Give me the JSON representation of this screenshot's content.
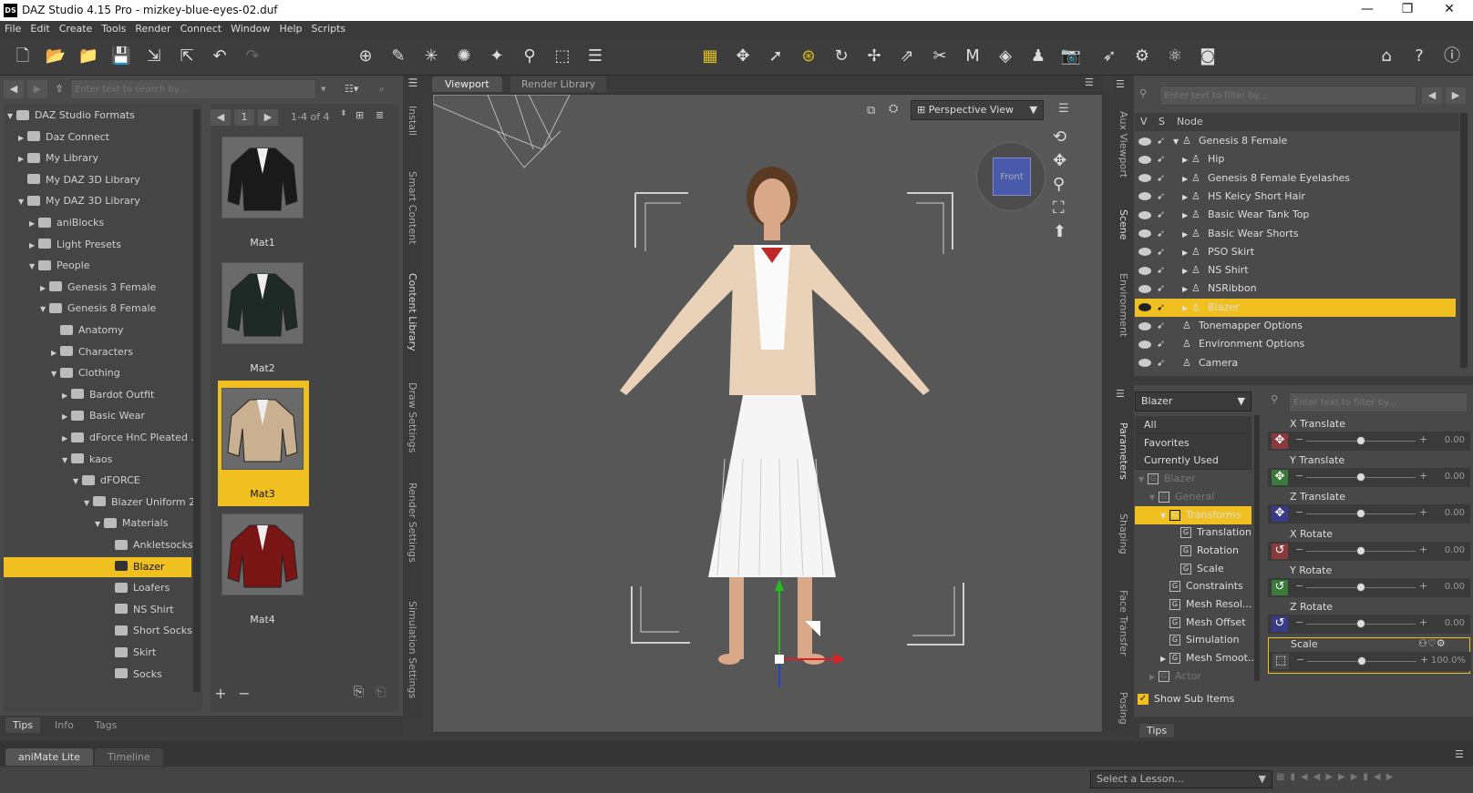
{
  "window": {
    "title": "DAZ Studio 4.15 Pro - mizkey-blue-eyes-02.duf",
    "logo": "DS"
  },
  "menu": [
    "File",
    "Edit",
    "Create",
    "Tools",
    "Render",
    "Connect",
    "Window",
    "Help",
    "Scripts"
  ],
  "content_library": {
    "search_placeholder": "Enter text to search by...",
    "tree": [
      {
        "label": "DAZ Studio Formats",
        "indent": 0,
        "arrow": "▼"
      },
      {
        "label": "Daz Connect",
        "indent": 1,
        "arrow": "▶"
      },
      {
        "label": "My Library",
        "indent": 1,
        "arrow": "▶"
      },
      {
        "label": "My DAZ 3D Library",
        "indent": 1,
        "arrow": ""
      },
      {
        "label": "My DAZ 3D Library",
        "indent": 1,
        "arrow": "▼"
      },
      {
        "label": "aniBlocks",
        "indent": 2,
        "arrow": "▶"
      },
      {
        "label": "Light Presets",
        "indent": 2,
        "arrow": "▶"
      },
      {
        "label": "People",
        "indent": 2,
        "arrow": "▼"
      },
      {
        "label": "Genesis 3 Female",
        "indent": 3,
        "arrow": "▶"
      },
      {
        "label": "Genesis 8 Female",
        "indent": 3,
        "arrow": "▼"
      },
      {
        "label": "Anatomy",
        "indent": 4,
        "arrow": ""
      },
      {
        "label": "Characters",
        "indent": 4,
        "arrow": "▶"
      },
      {
        "label": "Clothing",
        "indent": 4,
        "arrow": "▼"
      },
      {
        "label": "Bardot Outfit",
        "indent": 5,
        "arrow": "▶"
      },
      {
        "label": "Basic Wear",
        "indent": 5,
        "arrow": "▶"
      },
      {
        "label": "dForce HnC Pleated ...",
        "indent": 5,
        "arrow": "▶"
      },
      {
        "label": "kaos",
        "indent": 5,
        "arrow": "▼"
      },
      {
        "label": "dFORCE",
        "indent": 6,
        "arrow": "▼"
      },
      {
        "label": "Blazer Uniform 2",
        "indent": 7,
        "arrow": "▼"
      },
      {
        "label": "Materials",
        "indent": 8,
        "arrow": "▼"
      },
      {
        "label": "Ankletsocks",
        "indent": 9,
        "arrow": ""
      },
      {
        "label": "Blazer",
        "indent": 9,
        "arrow": "",
        "selected": true
      },
      {
        "label": "Loafers",
        "indent": 9,
        "arrow": ""
      },
      {
        "label": "NS Shirt",
        "indent": 9,
        "arrow": ""
      },
      {
        "label": "Short Socks",
        "indent": 9,
        "arrow": ""
      },
      {
        "label": "Skirt",
        "indent": 9,
        "arrow": ""
      },
      {
        "label": "Socks",
        "indent": 9,
        "arrow": ""
      }
    ],
    "page": "1",
    "range": "1-4 of 4",
    "thumbs": [
      {
        "label": "Mat1",
        "color": "#1a1a1a"
      },
      {
        "label": "Mat2",
        "color": "#1e2a26"
      },
      {
        "label": "Mat3",
        "color": "#c8b090",
        "selected": true
      },
      {
        "label": "Mat4",
        "color": "#7a1515"
      }
    ],
    "tabs": [
      "Tips",
      "Info",
      "Tags"
    ]
  },
  "side_tabs_left": [
    "Install",
    "Smart Content",
    "Content Library",
    "Draw Settings",
    "Render Settings",
    "Simulation Settings"
  ],
  "viewport": {
    "tabs": [
      "Viewport",
      "Render Library"
    ],
    "view_mode": "Perspective View",
    "cube_label": "Front"
  },
  "scene": {
    "filter_placeholder": "Enter text to filter by...",
    "headers": [
      "V",
      "S",
      "Node"
    ],
    "rows": [
      {
        "label": "Genesis 8 Female",
        "indent": 0,
        "arrow": "▼"
      },
      {
        "label": "Hip",
        "indent": 1,
        "arrow": "▶"
      },
      {
        "label": "Genesis 8 Female Eyelashes",
        "indent": 1,
        "arrow": "▶"
      },
      {
        "label": "HS Keicy Short Hair",
        "indent": 1,
        "arrow": "▶"
      },
      {
        "label": "Basic Wear Tank Top",
        "indent": 1,
        "arrow": "▶"
      },
      {
        "label": "Basic Wear Shorts",
        "indent": 1,
        "arrow": "▶"
      },
      {
        "label": "PSO Skirt",
        "indent": 1,
        "arrow": "▶"
      },
      {
        "label": "NS Shirt",
        "indent": 1,
        "arrow": "▶"
      },
      {
        "label": "NSRibbon",
        "indent": 1,
        "arrow": "▶"
      },
      {
        "label": "Blazer",
        "indent": 1,
        "arrow": "▶",
        "selected": true
      },
      {
        "label": "Tonemapper Options",
        "indent": 0,
        "arrow": ""
      },
      {
        "label": "Environment Options",
        "indent": 0,
        "arrow": ""
      },
      {
        "label": "Camera",
        "indent": 0,
        "arrow": ""
      }
    ]
  },
  "side_tabs_right": [
    "Aux Viewport",
    "Scene",
    "Environment",
    "Parameters",
    "Shaping",
    "Face Transfer",
    "Posing"
  ],
  "parameters": {
    "node": "Blazer",
    "filter_placeholder": "Enter text to filter by...",
    "groups": [
      {
        "label": "All",
        "indent": 0
      },
      {
        "label": "Favorites",
        "indent": 0
      },
      {
        "label": "Currently Used",
        "indent": 0
      },
      {
        "label": "Blazer",
        "indent": 0,
        "dim": true,
        "arrow": "▼"
      },
      {
        "label": "General",
        "indent": 1,
        "dim": true,
        "arrow": "▼"
      },
      {
        "label": "Transforms",
        "indent": 2,
        "selected": true,
        "arrow": "▼"
      },
      {
        "label": "Translation",
        "indent": 3
      },
      {
        "label": "Rotation",
        "indent": 3
      },
      {
        "label": "Scale",
        "indent": 3
      },
      {
        "label": "Constraints",
        "indent": 2
      },
      {
        "label": "Mesh Resol...",
        "indent": 2
      },
      {
        "label": "Mesh Offset",
        "indent": 2
      },
      {
        "label": "Simulation",
        "indent": 2
      },
      {
        "label": "Mesh Smoot...",
        "indent": 2,
        "arrow": "▶"
      },
      {
        "label": "Actor",
        "indent": 1,
        "dim": true,
        "arrow": "▶"
      }
    ],
    "show_sub": "Show Sub Items",
    "sliders": [
      {
        "name": "X Translate",
        "value": "0.00",
        "color": "#8a3a3a",
        "pos": 0.5
      },
      {
        "name": "Y Translate",
        "value": "0.00",
        "color": "#3a7a3a",
        "pos": 0.5
      },
      {
        "name": "Z Translate",
        "value": "0.00",
        "color": "#3a3a8a",
        "pos": 0.5
      },
      {
        "name": "X Rotate",
        "value": "0.00",
        "color": "#8a3a3a",
        "pos": 0.5
      },
      {
        "name": "Y Rotate",
        "value": "0.00",
        "color": "#3a7a3a",
        "pos": 0.5
      },
      {
        "name": "Z Rotate",
        "value": "0.00",
        "color": "#3a3a8a",
        "pos": 0.5
      },
      {
        "name": "Scale",
        "value": "100.0%",
        "color": "#4a4a4a",
        "pos": 0.5
      }
    ],
    "tips": "Tips"
  },
  "bottom": {
    "tabs": [
      "aniMate Lite",
      "Timeline"
    ],
    "lesson": "Select a Lesson..."
  }
}
